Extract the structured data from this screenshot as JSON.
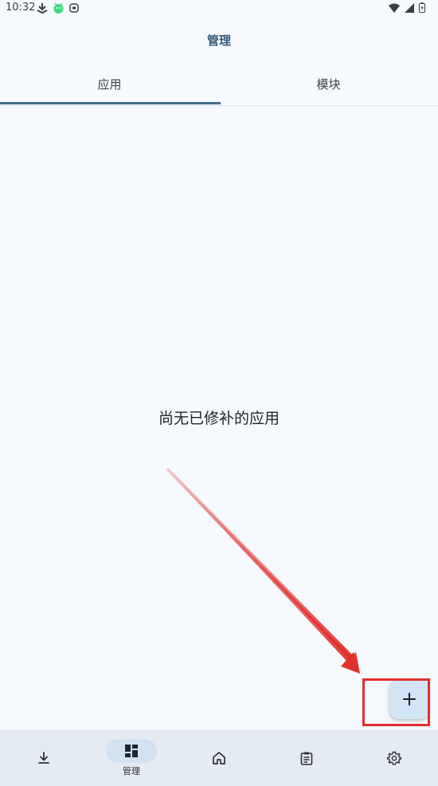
{
  "status_bar": {
    "time": "10:32"
  },
  "header": {
    "title": "管理"
  },
  "tabs": [
    {
      "label": "应用",
      "selected": true
    },
    {
      "label": "模块",
      "selected": false
    }
  ],
  "empty_state": {
    "message": "尚无已修补的应用"
  },
  "fab": {
    "icon": "plus-icon"
  },
  "bottom_nav": {
    "items": [
      {
        "icon": "download-icon",
        "label": "",
        "active": false
      },
      {
        "icon": "dashboard-icon",
        "label": "管理",
        "active": true
      },
      {
        "icon": "home-icon",
        "label": "",
        "active": false
      },
      {
        "icon": "clipboard-icon",
        "label": "",
        "active": false
      },
      {
        "icon": "gear-icon",
        "label": "",
        "active": false
      }
    ]
  },
  "colors": {
    "background": "#f6f9fd",
    "accent": "#3b6a8c",
    "fab": "#d4e4f7",
    "nav_bar": "#e4ebf3",
    "annotation": "#e0302c"
  }
}
